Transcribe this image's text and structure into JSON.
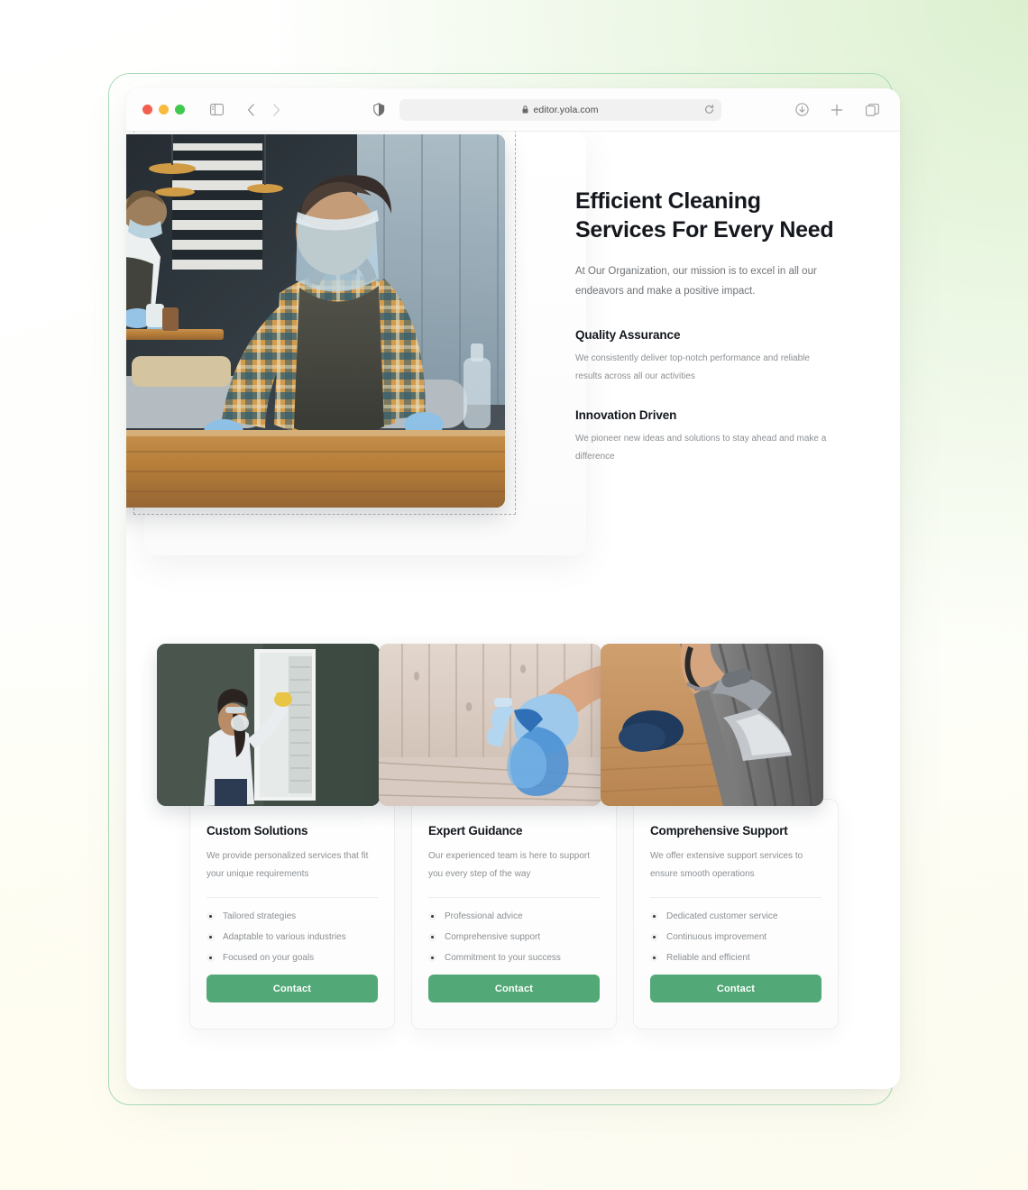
{
  "browser": {
    "url": "editor.yola.com",
    "icons": {
      "traffic_close": "close-window-dot",
      "traffic_minimize": "minimize-window-dot",
      "traffic_zoom": "zoom-window-dot",
      "sidebar": "sidebar-toggle-icon",
      "back": "back-arrow-icon",
      "forward": "forward-arrow-icon",
      "shield": "privacy-shield-icon",
      "lock": "lock-icon",
      "reload": "reload-icon",
      "downloads": "downloads-icon",
      "new_tab": "plus-icon",
      "tab_overview": "tab-overview-icon"
    }
  },
  "hero": {
    "title_line1": "Efficient Cleaning",
    "title_line2": "Services For Every Need",
    "subtitle": "At Our Organization, our mission is to excel in all our endeavors and make a positive impact.",
    "image_alt": "worker-in-plaid-shirt-disinfecting-cafe-table",
    "features": [
      {
        "title": "Quality Assurance",
        "body": "We consistently deliver top-notch performance and reliable results across all our activities"
      },
      {
        "title": "Innovation Driven",
        "body": "We pioneer new ideas and solutions to stay ahead and make a difference"
      }
    ]
  },
  "theme": {
    "accent": "#52a977",
    "accent_text": "#ffffff",
    "heading": "#14181d",
    "body_text": "#8b8f93",
    "frame_outline": "#a9dcb8"
  },
  "cards": [
    {
      "image_alt": "woman-in-mask-cleaning-window-blinds",
      "title": "Custom Solutions",
      "desc": "We provide personalized services that fit your unique requirements",
      "bullets": [
        "Tailored strategies",
        "Adaptable to various industries",
        "Focused on your goals"
      ],
      "button": "Contact"
    },
    {
      "image_alt": "gloved-hand-holding-blue-spray-bottle-on-wooden-floor",
      "title": "Expert Guidance",
      "desc": "Our experienced team is here to support you every step of the way",
      "bullets": [
        "Professional advice",
        "Comprehensive support",
        "Commitment to your success"
      ],
      "button": "Contact"
    },
    {
      "image_alt": "person-steam-cleaning-grey-sofa-upholstery",
      "title": "Comprehensive Support",
      "desc": "We offer extensive support services to ensure smooth operations",
      "bullets": [
        "Dedicated customer service",
        "Continuous improvement",
        "Reliable and efficient"
      ],
      "button": "Contact"
    }
  ]
}
